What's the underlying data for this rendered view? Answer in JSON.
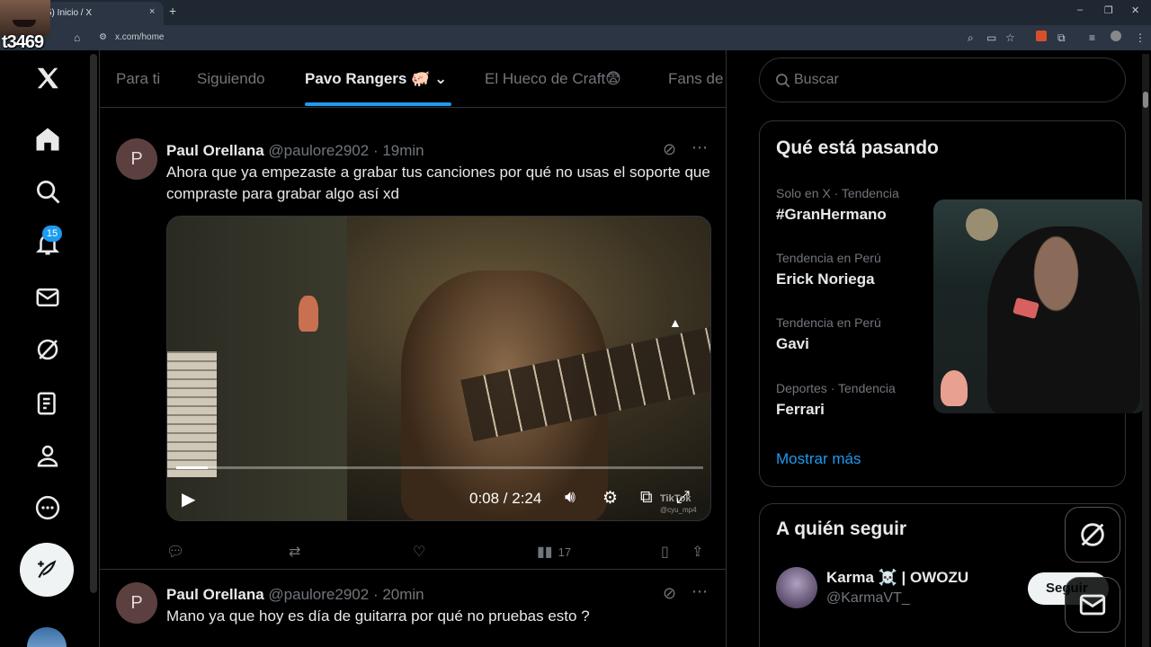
{
  "browser": {
    "tab_title": "5) Inicio / X",
    "tab_close": "×",
    "new_tab": "+",
    "url": "x.com/home",
    "window_controls": [
      "–",
      "❐",
      "✕"
    ]
  },
  "streamer_overlay": {
    "name": "t3469"
  },
  "nav": {
    "items": [
      "x-logo",
      "home",
      "explore",
      "notifications",
      "messages",
      "grok",
      "lists",
      "profile",
      "more"
    ],
    "notifications_badge": "15"
  },
  "feed_tabs": [
    {
      "label": "Para ti",
      "active": false
    },
    {
      "label": "Siguiendo",
      "active": false
    },
    {
      "label": "Pavo Rangers 🐖",
      "active": true
    },
    {
      "label": "El Hueco de Craft😨",
      "active": false
    },
    {
      "label": "Fans de",
      "active": false
    }
  ],
  "tweets": [
    {
      "avatar_letter": "P",
      "name": "Paul Orellana",
      "handle": "@paulore2902",
      "time": "· 19min",
      "text": "Ahora que ya empezaste a grabar tus canciones por qué no usas el soporte que compraste para grabar algo así xd",
      "video": {
        "time": "0:08 / 2:24",
        "progress": 0.06,
        "brand": "TikTok",
        "brand_handle": "@cyu_mp4"
      },
      "views": "17"
    },
    {
      "avatar_letter": "P",
      "name": "Paul Orellana",
      "handle": "@paulore2902",
      "time": "· 20min",
      "text": "Mano ya que hoy es día de guitarra por qué no pruebas esto ?"
    }
  ],
  "search": {
    "placeholder": "Buscar"
  },
  "trends": {
    "title": "Qué está pasando",
    "items": [
      {
        "category": "Solo en X · Tendencia",
        "name": "#GranHermano"
      },
      {
        "category": "Tendencia en Perú",
        "name": "Erick Noriega"
      },
      {
        "category": "Tendencia en Perú",
        "name": "Gavi"
      },
      {
        "category": "Deportes · Tendencia",
        "name": "Ferrari"
      }
    ],
    "show_more": "Mostrar más"
  },
  "who_to_follow": {
    "title": "A quién seguir",
    "items": [
      {
        "name": "Karma ☠️ | OWOZU",
        "handle": "@KarmaVT_",
        "button": "Seguir"
      }
    ]
  },
  "colors": {
    "accent": "#1d9bf0",
    "background": "#000000",
    "border": "#2f3336",
    "muted": "#71767b"
  }
}
